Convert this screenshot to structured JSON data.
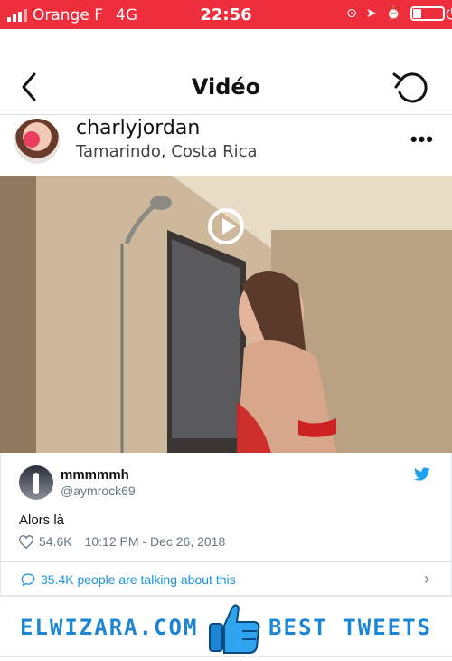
{
  "status_bar": {
    "carrier": "Orange F",
    "network": "4G",
    "time": "22:56"
  },
  "nav": {
    "title": "Vidéo"
  },
  "post": {
    "username": "charlyjordan",
    "location": "Tamarindo, Costa Rica"
  },
  "tweet": {
    "name": "mmmmmh",
    "handle": "@aymrock69",
    "text": "Alors là",
    "likes": "54.6K",
    "datetime": "10:12 PM - Dec 26, 2018",
    "talking": "35.4K people are talking about this"
  },
  "banner": {
    "left": "ELWIZARA.COM",
    "right": "BEST TWEETS"
  },
  "colors": {
    "status_bar": "#ee2e3c",
    "twitter_blue": "#1b95e0",
    "brand_blue": "#1d86d4"
  }
}
